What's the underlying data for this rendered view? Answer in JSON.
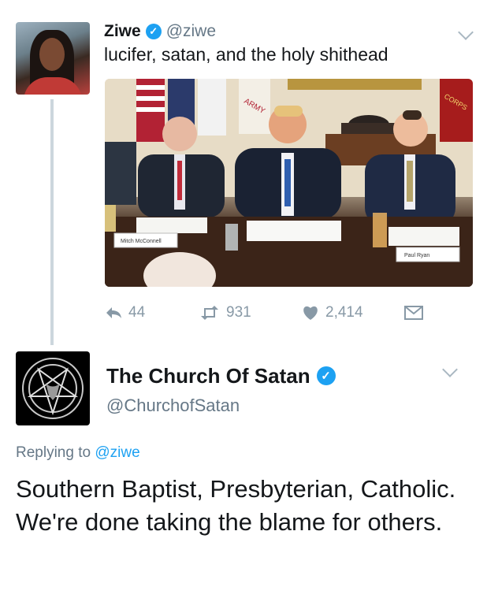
{
  "tweet1": {
    "display_name": "Ziwe",
    "handle": "@ziwe",
    "text": "lucifer, satan, and the holy shithead",
    "media": {
      "nameplates": [
        "Mitch McConnell",
        "Paul Ryan"
      ],
      "flag_text": [
        "ARMY",
        "CORPS"
      ]
    },
    "actions": {
      "reply_icon": "reply-icon",
      "reply_count": "44",
      "retweet_icon": "retweet-icon",
      "retweet_count": "931",
      "like_icon": "heart-icon",
      "like_count": "2,414",
      "dm_icon": "envelope-icon"
    },
    "verified_icon": "verified-badge-icon",
    "menu_icon": "chevron-down-icon"
  },
  "tweet2": {
    "display_name": "The Church Of Satan",
    "handle": "@ChurchofSatan",
    "replying_prefix": "Replying to",
    "replying_to": "@ziwe",
    "text": "Southern Baptist, Presbyterian, Catholic. We're done taking the blame for others.",
    "avatar_icon": "sigil-of-baphomet-icon",
    "verified_icon": "verified-badge-icon",
    "menu_icon": "chevron-down-icon"
  },
  "colors": {
    "accent": "#1da1f2",
    "secondary_text": "#657786",
    "action_gray": "#8899a6",
    "thread_line": "#ccd6dd"
  }
}
